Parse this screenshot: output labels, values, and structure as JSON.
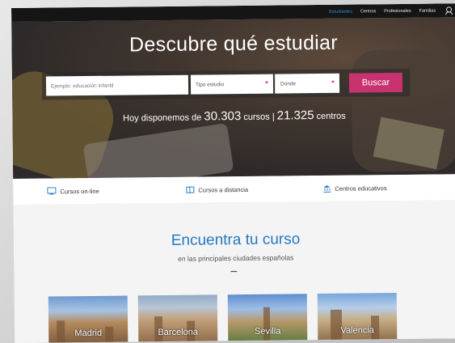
{
  "topnav": {
    "items": [
      "Estudiantes",
      "Centros",
      "Profesionales",
      "Familias"
    ],
    "active_color": "#2f8fd9"
  },
  "hero": {
    "title": "Descubre qué estudiar",
    "search_placeholder": "Ejemplo: educación infantil",
    "select_tipo": "Tipo estudio",
    "select_donde": "Dónde",
    "search_button": "Buscar",
    "stats_prefix": "Hoy disponemos de ",
    "stats_courses_count": "30.303",
    "stats_courses_label": " cursos | ",
    "stats_centers_count": "21.325",
    "stats_centers_label": " centros"
  },
  "features": [
    {
      "label": "Cursos on-line",
      "icon": "monitor-icon"
    },
    {
      "label": "Cursos a distancia",
      "icon": "books-icon"
    },
    {
      "label": "Centros educativos",
      "icon": "building-icon"
    }
  ],
  "find": {
    "title": "Encuentra tu curso",
    "subtitle": "en las principales ciudades españolas"
  },
  "cities": [
    "Madrid",
    "Barcelona",
    "Sevilla",
    "Valencia"
  ],
  "colors": {
    "accent_blue": "#2378c4",
    "button_pink": "#c8326e",
    "topbar": "#151515"
  }
}
